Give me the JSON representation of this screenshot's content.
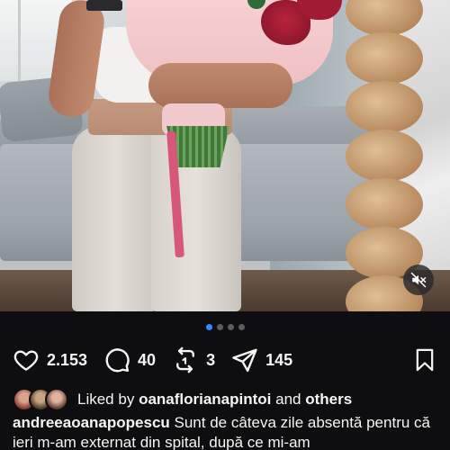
{
  "post": {
    "media": {
      "alt_icon": "mute-icon",
      "carousel_total": 4,
      "carousel_active": 1
    },
    "actions": {
      "likes": "2.153",
      "comments": "40",
      "reposts": "3",
      "shares": "145"
    },
    "liked_by": {
      "prefix": "Liked by",
      "user": "oanaflorianapintoi",
      "connector": "and",
      "others": "others"
    },
    "caption": {
      "username": "andreeaoanapopescu",
      "text": "Sunt de câteva zile absentă pentru că ieri m-am externat din spital, după ce mi-am"
    }
  },
  "colors": {
    "background": "#0e0e10",
    "active_dot": "#3a86ff",
    "inactive_dot": "#5b5b60",
    "text": "#f5f5f5"
  }
}
